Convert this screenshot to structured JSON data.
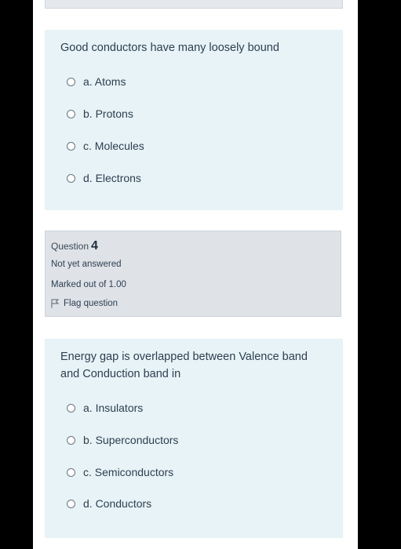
{
  "question3": {
    "text": "Good conductors have many loosely bound",
    "options": [
      "a. Atoms",
      "b. Protons",
      "c. Molecules",
      "d. Electrons"
    ]
  },
  "question4_info": {
    "label": "Question",
    "number": "4",
    "status": "Not yet answered",
    "marks": "Marked out of 1.00",
    "flag": "Flag question"
  },
  "question4": {
    "text_line1": "Energy gap is overlapped between Valence band",
    "text_line2": "and Conduction band in",
    "options": [
      "a. Insulators",
      "b. Superconductors",
      "c. Semiconductors",
      "d. Conductors"
    ]
  }
}
